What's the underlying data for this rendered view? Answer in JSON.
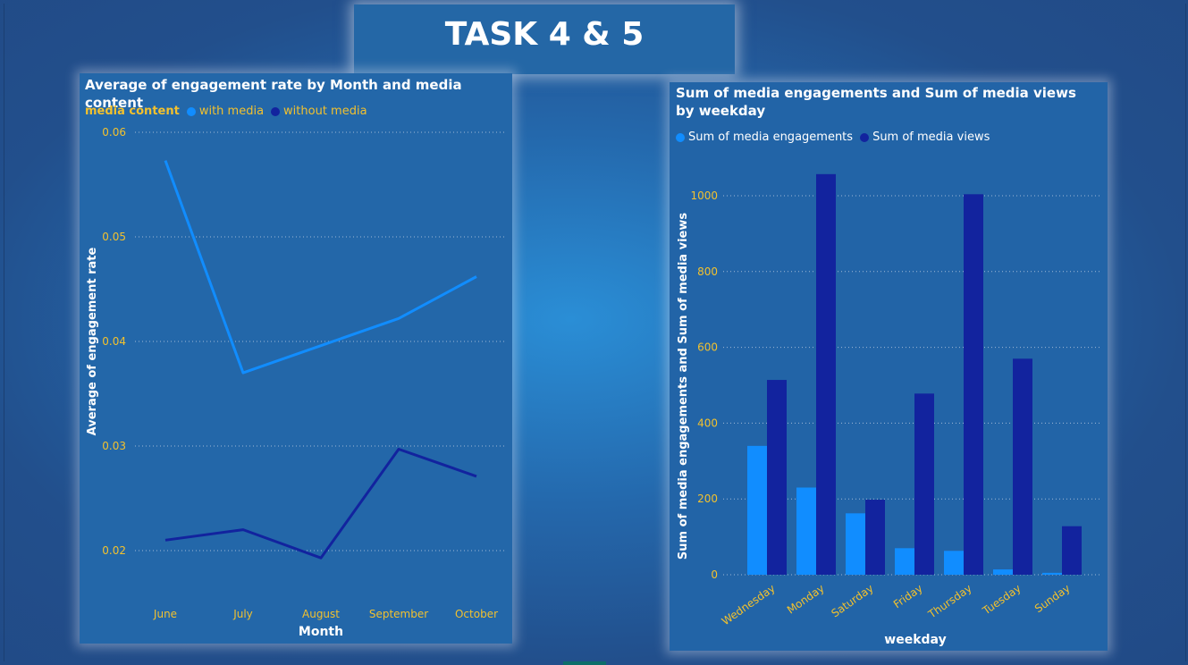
{
  "header": {
    "title": "TASK 4 & 5"
  },
  "colors": {
    "with_media": "#118dff",
    "without_media": "#12239e",
    "engagements": "#118dff",
    "views": "#12239e",
    "tick_label": "#f2c12e"
  },
  "chart_data": [
    {
      "type": "line",
      "title": "Average of engagement rate by Month and media content",
      "xlabel": "Month",
      "ylabel": "Average of engagement rate",
      "legend_title": "media content",
      "legend_position": "top-left",
      "categories": [
        "June",
        "July",
        "August",
        "September",
        "October"
      ],
      "yticks": [
        "0.02",
        "0.03",
        "0.04",
        "0.05",
        "0.06"
      ],
      "ylim": [
        0.0185,
        0.06
      ],
      "grid": true,
      "series": [
        {
          "name": "with media",
          "values": [
            0.0573,
            0.037,
            0.0396,
            0.0422,
            0.0462
          ]
        },
        {
          "name": "without media",
          "values": [
            0.021,
            0.022,
            0.0193,
            0.0297,
            0.0271
          ]
        }
      ]
    },
    {
      "type": "bar",
      "title": "Sum of media engagements and Sum of media views by weekday",
      "xlabel": "weekday",
      "ylabel": "Sum of media engagements and Sum of media views",
      "legend_position": "top-left",
      "categories": [
        "Wednesday",
        "Monday",
        "Saturday",
        "Friday",
        "Thursday",
        "Tuesday",
        "Sunday"
      ],
      "yticks": [
        "0",
        "200",
        "400",
        "600",
        "800",
        "1000"
      ],
      "ylim": [
        0,
        1000
      ],
      "grid": true,
      "series": [
        {
          "name": "Sum of media engagements",
          "values": [
            340,
            230,
            162,
            70,
            63,
            14,
            5
          ]
        },
        {
          "name": "Sum of media views",
          "values": [
            514,
            1057,
            198,
            478,
            1004,
            570,
            128
          ]
        }
      ]
    }
  ]
}
